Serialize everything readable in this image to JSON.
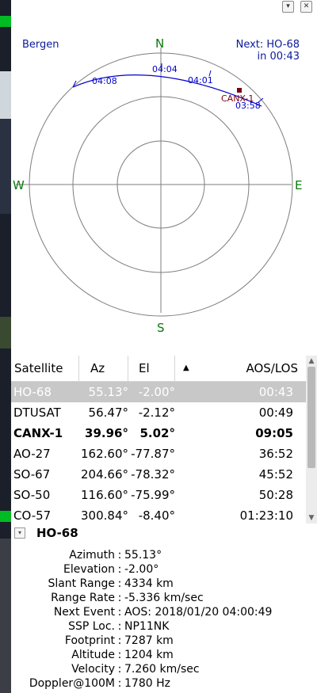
{
  "window": {
    "float_button": "▾",
    "close_button": "✕"
  },
  "polar": {
    "qth_name": "Bergen",
    "next_line1": "Next: HO-68",
    "next_line2": "in 00:43",
    "directions": {
      "n": "N",
      "s": "S",
      "e": "E",
      "w": "W"
    },
    "track_times": [
      "04:08",
      "04:04",
      "04:01",
      "03:58"
    ],
    "satellite_label": "CANX-1",
    "colors": {
      "track": "#0000cc",
      "sat_marker": "#7a0015",
      "compass": "#0a7a0a",
      "grid": "#7d7d7d"
    }
  },
  "table": {
    "columns": [
      "Satellite",
      "Az",
      "El",
      "AOS/LOS"
    ],
    "sort_indicator": "▲",
    "rows": [
      {
        "sat": "HO-68",
        "az": "55.13°",
        "el": "-2.00°",
        "aos": "00:43",
        "selected": true
      },
      {
        "sat": "DTUSAT",
        "az": "56.47°",
        "el": "-2.12°",
        "aos": "00:49"
      },
      {
        "sat": "CANX-1",
        "az": "39.96°",
        "el": "5.02°",
        "aos": "09:05",
        "bold": true
      },
      {
        "sat": "AO-27",
        "az": "162.60°",
        "el": "-77.87°",
        "aos": "36:52"
      },
      {
        "sat": "SO-67",
        "az": "204.66°",
        "el": "-78.32°",
        "aos": "45:52"
      },
      {
        "sat": "SO-50",
        "az": "116.60°",
        "el": "-75.99°",
        "aos": "50:28"
      },
      {
        "sat": "CO-57",
        "az": "300.84°",
        "el": "-8.40°",
        "aos": "01:23:10"
      }
    ]
  },
  "details": {
    "toggle": "▾",
    "satellite": "HO-68",
    "fields": [
      {
        "label": "Azimuth",
        "value": "55.13°"
      },
      {
        "label": "Elevation",
        "value": "-2.00°"
      },
      {
        "label": "Slant Range",
        "value": "4334 km"
      },
      {
        "label": "Range Rate",
        "value": "-5.336 km/sec"
      },
      {
        "label": "Next Event",
        "value": "AOS: 2018/01/20 04:00:49"
      },
      {
        "label": "SSP Loc.",
        "value": "NP11NK"
      },
      {
        "label": "Footprint",
        "value": "7287 km"
      },
      {
        "label": "Altitude",
        "value": "1204 km"
      },
      {
        "label": "Velocity",
        "value": "7.260 km/sec"
      },
      {
        "label": "Doppler@100M",
        "value": "1780 Hz"
      }
    ]
  }
}
